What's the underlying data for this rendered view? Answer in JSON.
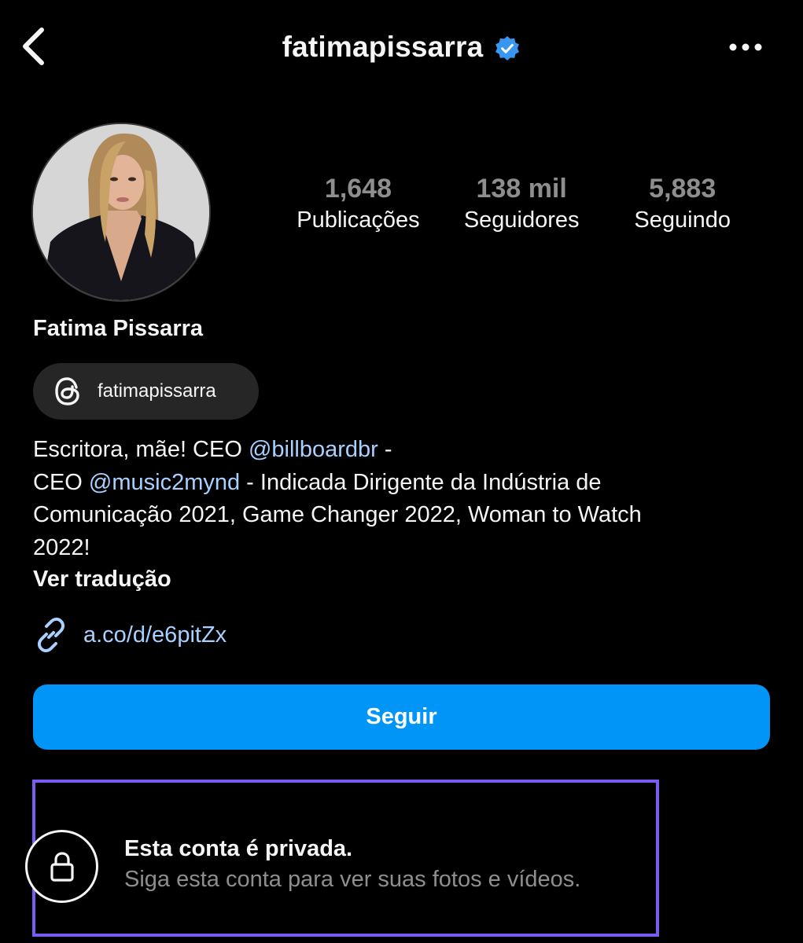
{
  "header": {
    "username": "fatimapissarra",
    "verified": true
  },
  "profile": {
    "full_name": "Fatima Pissarra",
    "stats": [
      {
        "value": "1,648",
        "label": "Publicações"
      },
      {
        "value": "138 mil",
        "label": "Seguidores"
      },
      {
        "value": "5,883",
        "label": "Seguindo"
      }
    ],
    "threads_handle": "fatimapissarra",
    "bio": {
      "line1_prefix": "Escritora, mãe! CEO ",
      "mention1": "@billboardbr",
      "line1_suffix": " -",
      "line2_prefix": "CEO ",
      "mention2": "@music2mynd",
      "line2_suffix": " - Indicada Dirigente da Indústria de",
      "line3": "Comunicação 2021, Game Changer 2022, Woman to Watch",
      "line4": "2022!"
    },
    "see_translation": "Ver tradução",
    "link": "a.co/d/e6pitZx"
  },
  "actions": {
    "follow_label": "Seguir"
  },
  "private_notice": {
    "title": "Esta conta é privada.",
    "subtitle": "Siga esta conta para ver suas fotos e vídeos."
  },
  "colors": {
    "background": "#000000",
    "primary_button": "#0095f6",
    "mention": "#a8d1ff",
    "verified": "#3897f0",
    "highlight": "#7b5cf0",
    "muted": "#8e8e8e"
  }
}
